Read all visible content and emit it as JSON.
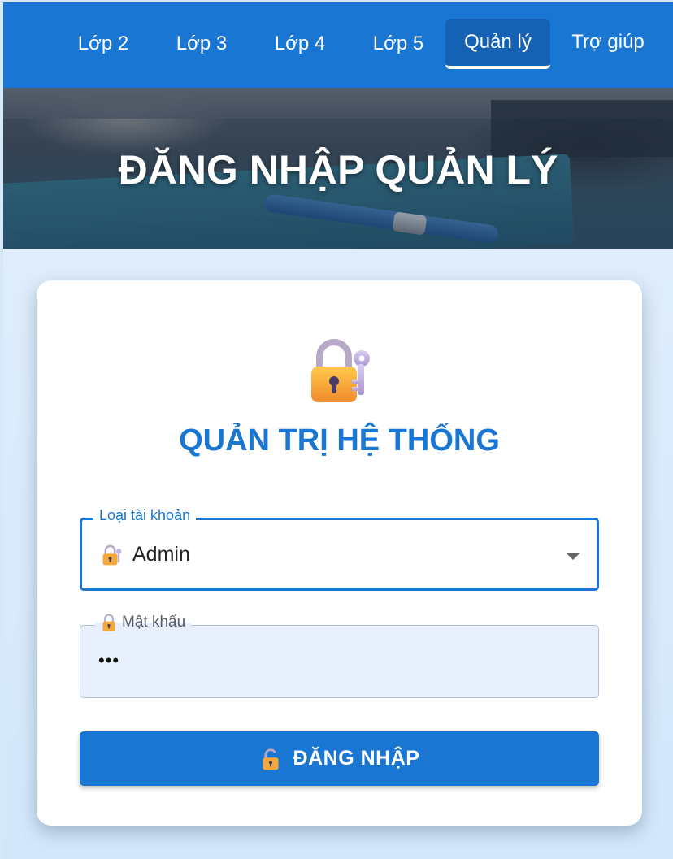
{
  "nav": {
    "items": [
      {
        "label": "Lớp 2"
      },
      {
        "label": "Lớp 3"
      },
      {
        "label": "Lớp 4"
      },
      {
        "label": "Lớp 5"
      },
      {
        "label": "Quản lý",
        "active": true
      },
      {
        "label": "Trợ giúp"
      }
    ]
  },
  "hero": {
    "title": "ĐĂNG NHẬP QUẢN LÝ"
  },
  "card": {
    "icon": "locked-with-key-icon",
    "title": "QUẢN TRỊ HỆ THỐNG",
    "account_type": {
      "label": "Loại tài khoản",
      "value": "Admin",
      "value_icon": "locked-with-key-icon"
    },
    "password": {
      "label": "Mật khẩu",
      "label_icon": "lock-icon",
      "value": "•••"
    },
    "login_button": {
      "label": "ĐĂNG NHẬP",
      "icon": "unlocked-icon"
    }
  },
  "colors": {
    "primary": "#1976d2",
    "nav_active": "#1561b4",
    "input_fill": "#e8f0fe"
  }
}
